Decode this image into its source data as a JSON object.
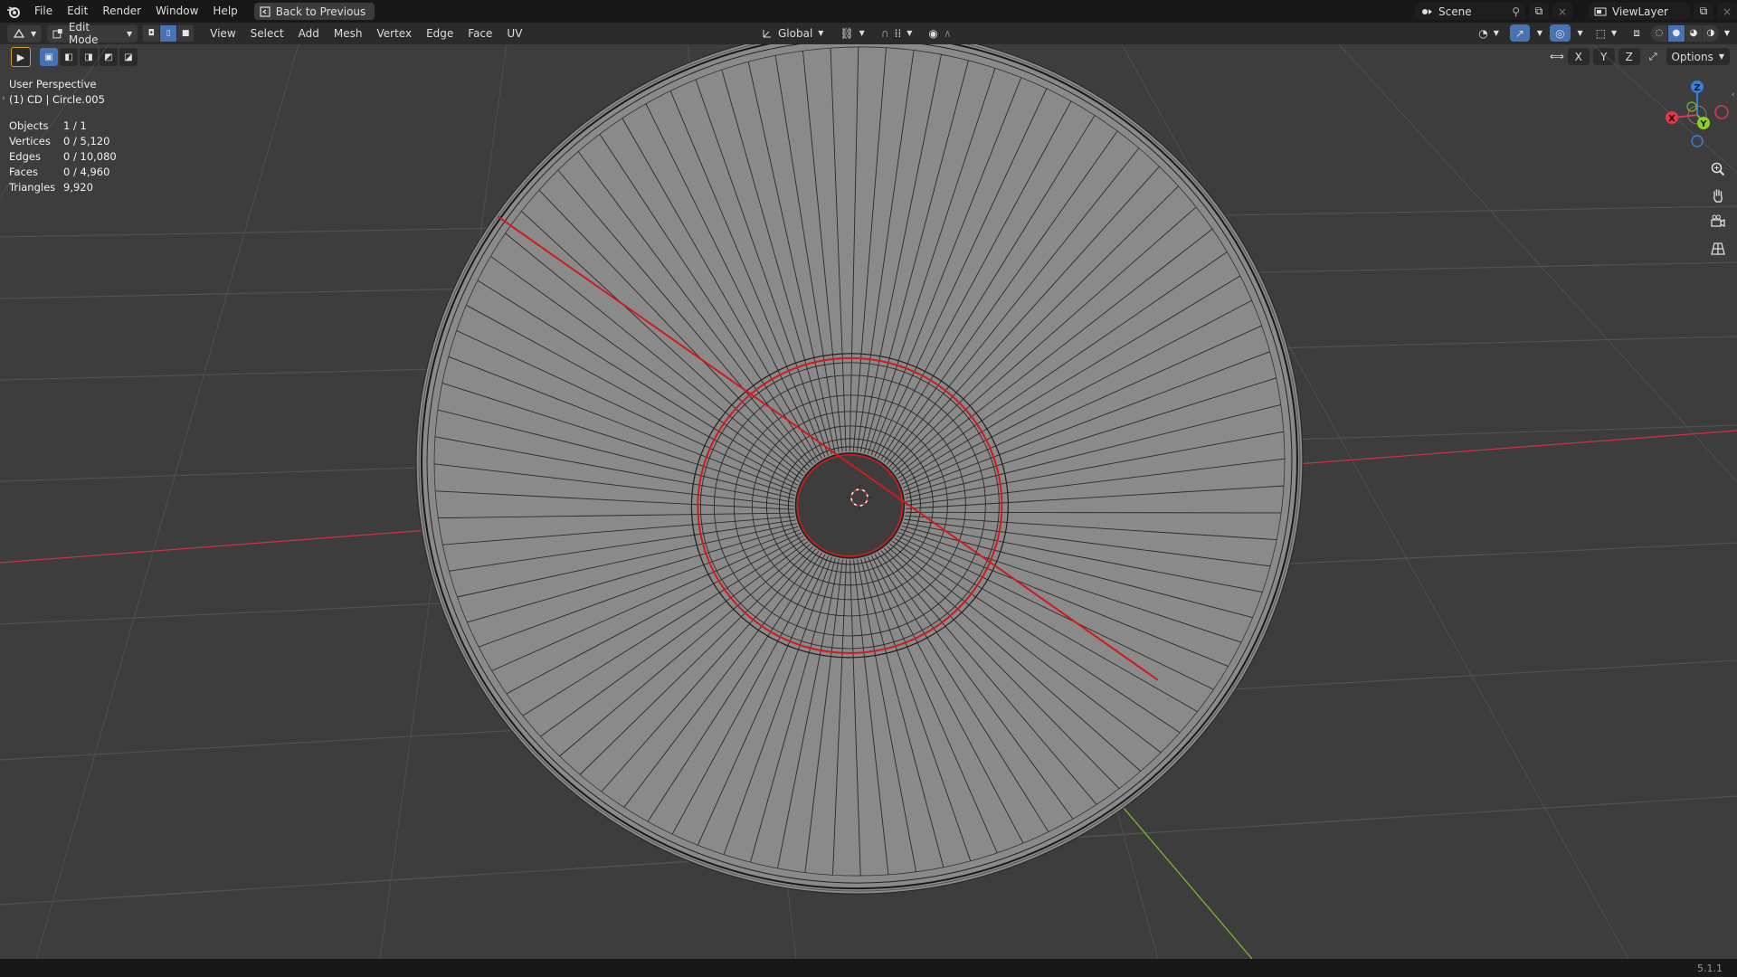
{
  "topbar": {
    "menus": [
      "File",
      "Edit",
      "Render",
      "Window",
      "Help"
    ],
    "back_button": "Back to Previous",
    "scene": "Scene",
    "view_layer": "ViewLayer"
  },
  "header": {
    "mode": "Edit Mode",
    "menus": [
      "View",
      "Select",
      "Add",
      "Mesh",
      "Vertex",
      "Edge",
      "Face",
      "UV"
    ],
    "orientation": "Global",
    "axes": [
      "X",
      "Y",
      "Z"
    ],
    "options": "Options"
  },
  "viewport": {
    "perspective": "User Perspective",
    "object": "(1) CD | Circle.005",
    "stats": [
      {
        "label": "Objects",
        "value": "1 / 1"
      },
      {
        "label": "Vertices",
        "value": "0 / 5,120"
      },
      {
        "label": "Edges",
        "value": "0 / 10,080"
      },
      {
        "label": "Faces",
        "value": "0 / 4,960"
      },
      {
        "label": "Triangles",
        "value": "9,920"
      }
    ]
  },
  "gizmo": {
    "x": "X",
    "y": "Y",
    "z": "Z"
  },
  "footer": {
    "version": "5.1.1"
  },
  "colors": {
    "selected_edge": "#d11a1a",
    "grid_x": "#c8313f",
    "grid_y": "#7ab82a",
    "mesh_face": "#8a8a8a"
  }
}
